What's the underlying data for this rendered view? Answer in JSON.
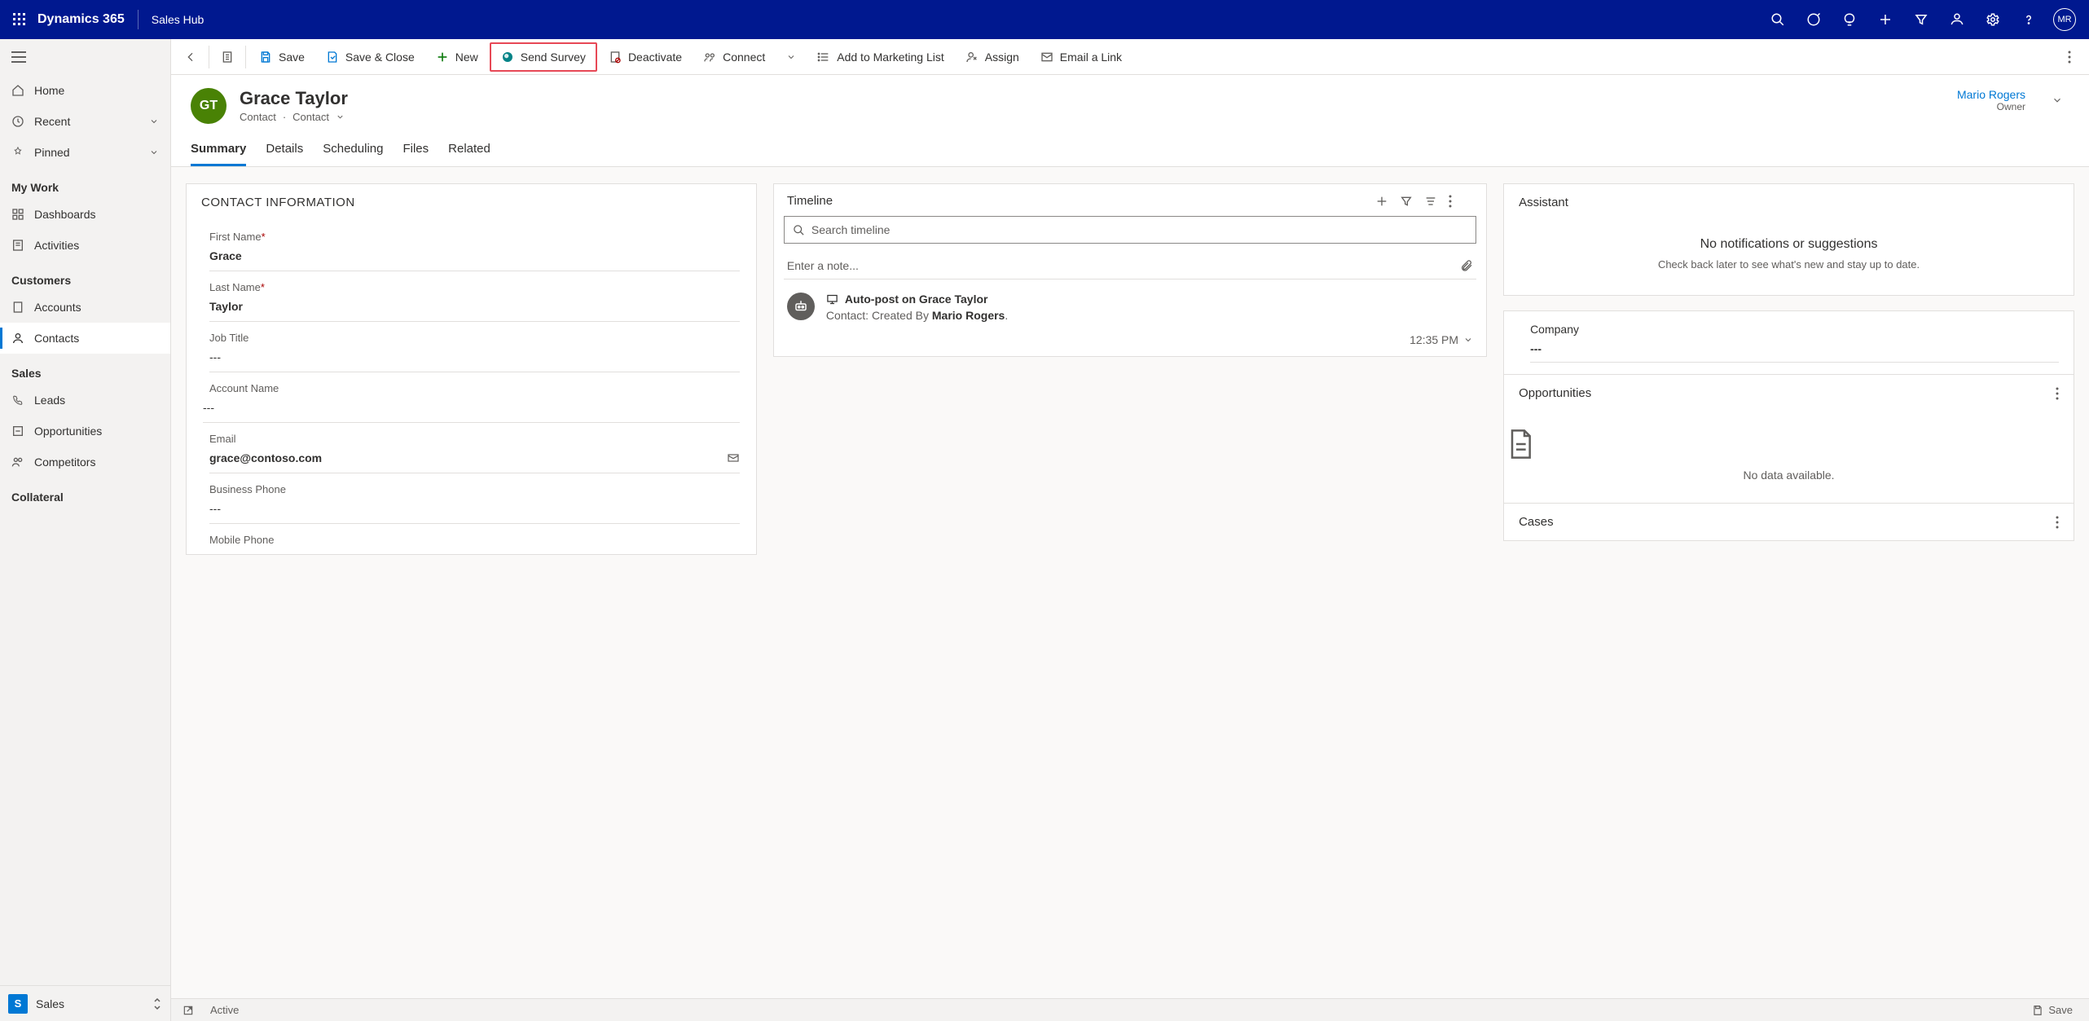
{
  "header": {
    "brand": "Dynamics 365",
    "hub": "Sales Hub",
    "avatar_initials": "MR"
  },
  "nav": {
    "home": "Home",
    "recent": "Recent",
    "pinned": "Pinned",
    "sections": {
      "my_work": "My Work",
      "customers": "Customers",
      "sales": "Sales",
      "collateral": "Collateral"
    },
    "items": {
      "dashboards": "Dashboards",
      "activities": "Activities",
      "accounts": "Accounts",
      "contacts": "Contacts",
      "leads": "Leads",
      "opportunities": "Opportunities",
      "competitors": "Competitors"
    },
    "footer_label": "Sales",
    "footer_badge": "S"
  },
  "cmd": {
    "save": "Save",
    "save_close": "Save & Close",
    "new": "New",
    "send_survey": "Send Survey",
    "deactivate": "Deactivate",
    "connect": "Connect",
    "add_marketing": "Add to Marketing List",
    "assign": "Assign",
    "email_link": "Email a Link"
  },
  "record": {
    "avatar": "GT",
    "title": "Grace Taylor",
    "entity": "Contact",
    "form": "Contact",
    "owner_name": "Mario Rogers",
    "owner_label": "Owner"
  },
  "tabs": {
    "summary": "Summary",
    "details": "Details",
    "scheduling": "Scheduling",
    "files": "Files",
    "related": "Related"
  },
  "contact_info": {
    "section": "CONTACT INFORMATION",
    "first_name_lbl": "First Name",
    "first_name": "Grace",
    "last_name_lbl": "Last Name",
    "last_name": "Taylor",
    "job_title_lbl": "Job Title",
    "job_title": "---",
    "account_lbl": "Account Name",
    "account": "---",
    "email_lbl": "Email",
    "email": "grace@contoso.com",
    "bus_phone_lbl": "Business Phone",
    "bus_phone": "---",
    "mob_phone_lbl": "Mobile Phone"
  },
  "timeline": {
    "title": "Timeline",
    "search_ph": "Search timeline",
    "note_ph": "Enter a note...",
    "item": {
      "title": "Auto-post on Grace Taylor",
      "line_pre": "Contact: Created By ",
      "line_bold": "Mario Rogers",
      "line_post": ".",
      "time": "12:35 PM"
    }
  },
  "assistant": {
    "title": "Assistant",
    "empty_title": "No notifications or suggestions",
    "empty_sub": "Check back later to see what's new and stay up to date.",
    "company_lbl": "Company",
    "company_val": "---",
    "opportunities": "Opportunities",
    "no_data": "No data available.",
    "cases": "Cases"
  },
  "status": {
    "state": "Active",
    "save": "Save"
  }
}
